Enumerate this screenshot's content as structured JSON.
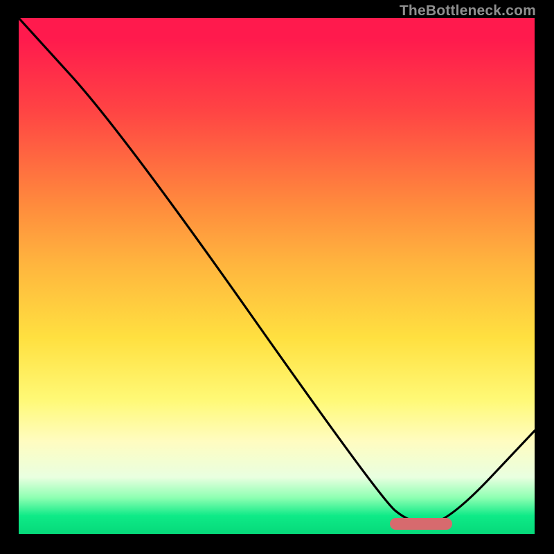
{
  "watermark": "TheBottleneck.com",
  "chart_data": {
    "type": "line",
    "title": "",
    "xlabel": "",
    "ylabel": "",
    "xlim": [
      0,
      100
    ],
    "ylim": [
      0,
      100
    ],
    "grid": false,
    "background": "red-yellow-green vertical gradient",
    "series": [
      {
        "name": "curve",
        "color": "#000000",
        "x": [
          0,
          20,
          70,
          76,
          83,
          100
        ],
        "y": [
          100,
          78,
          7,
          2,
          2,
          20
        ]
      }
    ],
    "annotations": [
      {
        "name": "optimal-range-marker",
        "shape": "rounded-bar",
        "color": "#d76a6e",
        "x_start": 72,
        "x_end": 84,
        "y": 2
      }
    ]
  },
  "colors": {
    "gradient_top": "#ff1a4d",
    "gradient_mid": "#ffe040",
    "gradient_bottom": "#06d97a",
    "curve": "#000000",
    "marker": "#d76a6e",
    "frame": "#000000",
    "watermark": "#8f8f8f"
  }
}
